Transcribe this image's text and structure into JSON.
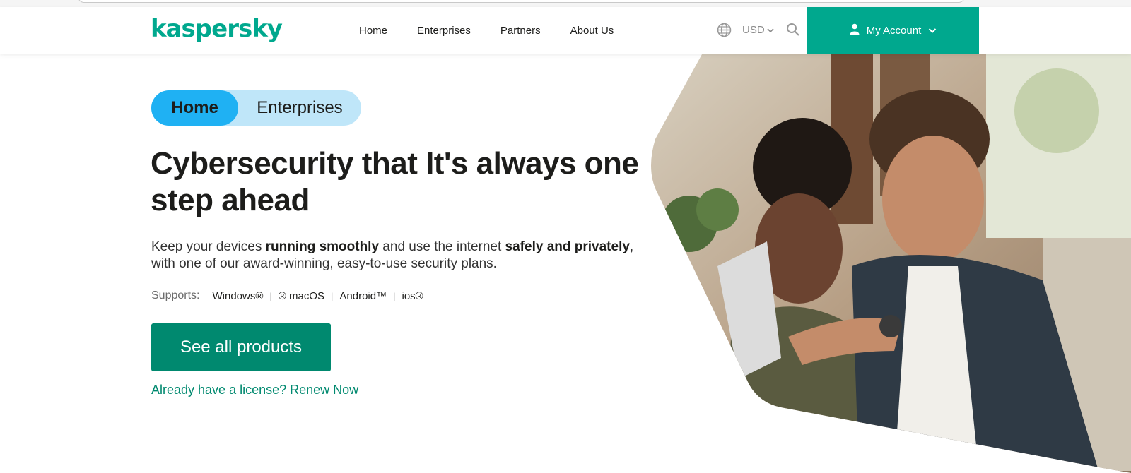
{
  "brand": {
    "logo_text": "kaspersky",
    "accent": "#00a88e",
    "cta_color": "#00896f"
  },
  "nav": {
    "items": [
      {
        "label": "Home"
      },
      {
        "label": "Enterprises"
      },
      {
        "label": "Partners"
      },
      {
        "label": "About Us"
      }
    ]
  },
  "header": {
    "globe_icon": "globe-icon",
    "currency": "USD",
    "search_icon": "search-icon",
    "account_label": "My Account"
  },
  "hero": {
    "toggle": {
      "active": "Home",
      "inactive": "Enterprises"
    },
    "title": "Cybersecurity that It's always one step ahead",
    "desc": {
      "p1": "Keep your devices ",
      "b1": "running smoothly",
      "p2": " and use the internet ",
      "b2": "safely and privately",
      "p3": ", with one of our award-winning, easy-to-use security plans."
    },
    "supports": {
      "label": "Supports:",
      "os": [
        "Windows®",
        "® macOS",
        "Android™",
        "ios®"
      ]
    },
    "cta_label": "See all products",
    "renew_link": "Already have a license? Renew Now"
  }
}
